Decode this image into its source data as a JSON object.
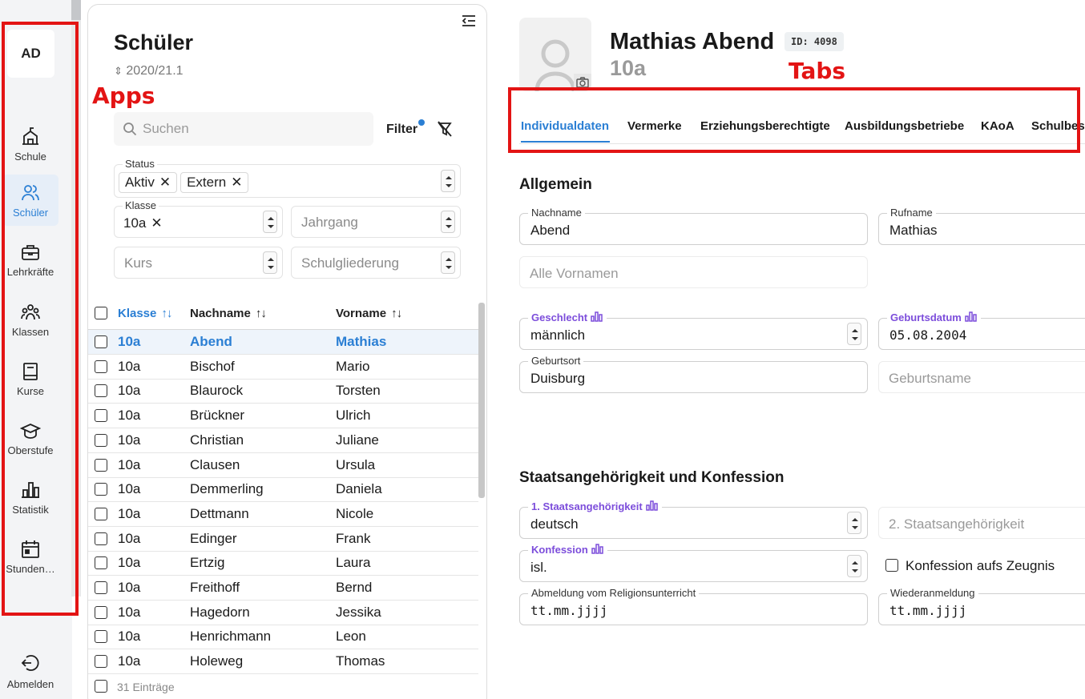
{
  "sidebar": {
    "user_initials": "AD",
    "items": [
      {
        "label": "Schule",
        "icon": "school-icon"
      },
      {
        "label": "Schüler",
        "icon": "users-icon",
        "active": true
      },
      {
        "label": "Lehrkräfte",
        "icon": "briefcase-icon"
      },
      {
        "label": "Klassen",
        "icon": "group-icon"
      },
      {
        "label": "Kurse",
        "icon": "book-icon"
      },
      {
        "label": "Oberstufe",
        "icon": "graduation-cap-icon"
      },
      {
        "label": "Statistik",
        "icon": "bar-chart-icon"
      },
      {
        "label": "Stunden…",
        "icon": "calendar-icon"
      }
    ],
    "logout_label": "Abmelden"
  },
  "annotations": {
    "apps_label": "Apps",
    "tabs_label": "Tabs",
    "color": "#e31414"
  },
  "list_panel": {
    "title": "Schüler",
    "school_year": "2020/21.1",
    "search_placeholder": "Suchen",
    "filter_label": "Filter",
    "status": {
      "legend": "Status",
      "chips": [
        "Aktiv",
        "Extern"
      ]
    },
    "klasse": {
      "legend": "Klasse",
      "chips": [
        "10a"
      ]
    },
    "jahrgang_placeholder": "Jahrgang",
    "kurs_placeholder": "Kurs",
    "schulgliederung_placeholder": "Schulgliederung",
    "columns": [
      "Klasse",
      "Nachname",
      "Vorname"
    ],
    "sort_glyph": "↑↓",
    "rows": [
      {
        "klasse": "10a",
        "nachname": "Abend",
        "vorname": "Mathias",
        "selected": true
      },
      {
        "klasse": "10a",
        "nachname": "Bischof",
        "vorname": "Mario"
      },
      {
        "klasse": "10a",
        "nachname": "Blaurock",
        "vorname": "Torsten"
      },
      {
        "klasse": "10a",
        "nachname": "Brückner",
        "vorname": "Ulrich"
      },
      {
        "klasse": "10a",
        "nachname": "Christian",
        "vorname": "Juliane"
      },
      {
        "klasse": "10a",
        "nachname": "Clausen",
        "vorname": "Ursula"
      },
      {
        "klasse": "10a",
        "nachname": "Demmerling",
        "vorname": "Daniela"
      },
      {
        "klasse": "10a",
        "nachname": "Dettmann",
        "vorname": "Nicole"
      },
      {
        "klasse": "10a",
        "nachname": "Edinger",
        "vorname": "Frank"
      },
      {
        "klasse": "10a",
        "nachname": "Ertzig",
        "vorname": "Laura"
      },
      {
        "klasse": "10a",
        "nachname": "Freithoff",
        "vorname": "Bernd"
      },
      {
        "klasse": "10a",
        "nachname": "Hagedorn",
        "vorname": "Jessika"
      },
      {
        "klasse": "10a",
        "nachname": "Henrichmann",
        "vorname": "Leon"
      },
      {
        "klasse": "10a",
        "nachname": "Holeweg",
        "vorname": "Thomas"
      }
    ],
    "footer": "31 Einträge"
  },
  "detail": {
    "name": "Mathias Abend",
    "id_badge": "ID: 4098",
    "klasse": "10a",
    "tabs": [
      "Individualdaten",
      "Vermerke",
      "Erziehungsberechtigte",
      "Ausbildungsbetriebe",
      "KAoA",
      "Schulbesu"
    ],
    "allgemein": {
      "title": "Allgemein",
      "nachname_label": "Nachname",
      "nachname": "Abend",
      "rufname_label": "Rufname",
      "rufname": "Mathias",
      "vornamen_placeholder": "Alle Vornamen",
      "geschlecht_label": "Geschlecht",
      "geschlecht": "männlich",
      "geburtsdatum_label": "Geburtsdatum",
      "geburtsdatum": "05.08.2004",
      "geburtsort_label": "Geburtsort",
      "geburtsort": "Duisburg",
      "geburtsname_placeholder": "Geburtsname"
    },
    "staat": {
      "title": "Staatsangehörigkeit und Konfession",
      "staat1_label": "1. Staatsangehörigkeit",
      "staat1": "deutsch",
      "staat2_placeholder": "2. Staatsangehörigkeit",
      "konfession_label": "Konfession",
      "konfession": "isl.",
      "zeugnis_label": "Konfession aufs Zeugnis",
      "abmeldung_label": "Abmeldung vom Religionsunterricht",
      "abmeldung": "tt.mm.jjjj",
      "wiederanmeldung_label": "Wiederanmeldung",
      "wiederanmeldung": "tt.mm.jjjj"
    }
  },
  "colors": {
    "accent": "#2b7fd4",
    "stat_purple": "#7c4ddb"
  }
}
